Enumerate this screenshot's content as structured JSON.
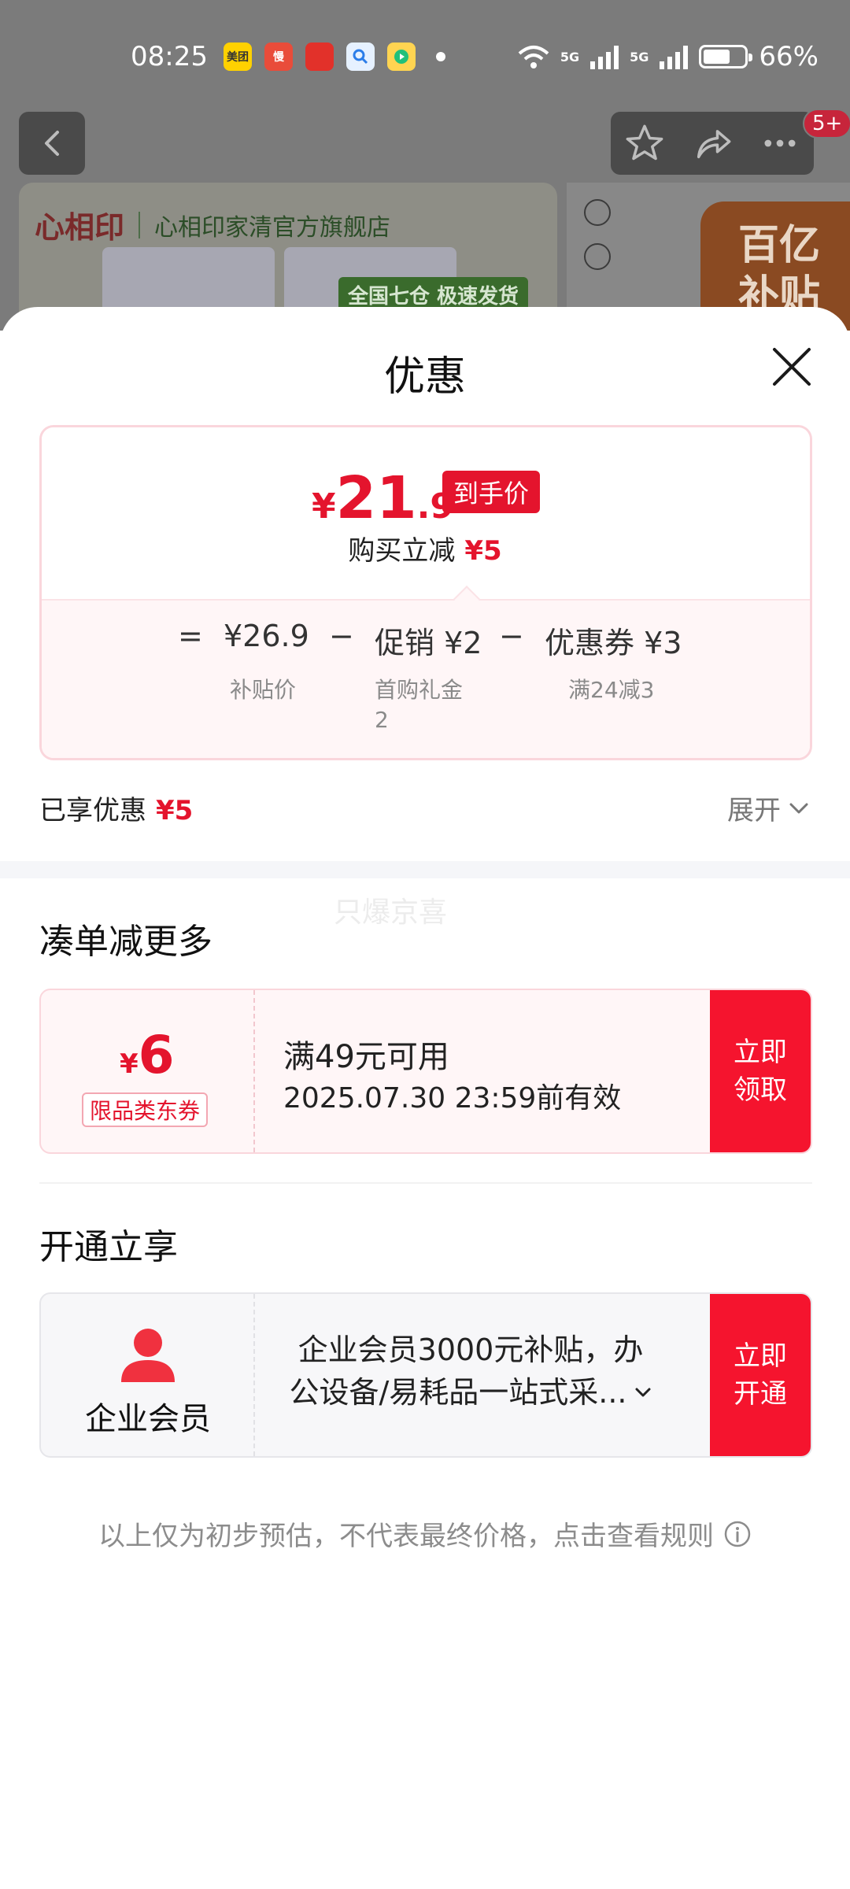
{
  "status_bar": {
    "time": "08:25",
    "app_icons": [
      {
        "name": "meituan-icon",
        "label": "美团",
        "color": "#ffd100"
      },
      {
        "name": "app-red-icon",
        "label": "慢",
        "color": "#e94c3a"
      },
      {
        "name": "app-pdd-icon",
        "label": "",
        "color": "#e2312a"
      },
      {
        "name": "app-search-icon",
        "label": "",
        "color": "#e6f1ff"
      },
      {
        "name": "app-video-icon",
        "label": "",
        "color": "#ffd451"
      }
    ],
    "signal1_label": "5G",
    "signal2_label": "5G",
    "battery_level": 0.66,
    "battery_text": "66%"
  },
  "background": {
    "store_logo": "心相印",
    "store_name": "心相印家清官方旗舰店",
    "banner_tag": "全国七仓 极速发货",
    "promo_badge_line1": "百亿",
    "promo_badge_line2": "补贴",
    "cart_badge": "5+"
  },
  "sheet": {
    "title": "优惠",
    "final_price": {
      "currency": "¥",
      "integer": "21",
      "decimal": ".9",
      "tag": "到手价"
    },
    "instant_discount": {
      "label": "购买立减",
      "amount": "¥5"
    },
    "breakdown": {
      "equals": "=",
      "minus": "−",
      "subsidy_price": "¥26.9",
      "subsidy_label": "补贴价",
      "promo": "促销 ¥2",
      "promo_label_line1": "首购礼金",
      "promo_label_line2": "2",
      "coupon": "优惠券 ¥3",
      "coupon_label": "满24减3"
    },
    "enjoyed": {
      "label": "已享优惠",
      "amount": "¥5"
    },
    "expand_label": "展开",
    "watermark": "只爆京喜",
    "more_section": {
      "title": "凑单减更多",
      "coupon": {
        "currency": "¥",
        "amount": "6",
        "type": "限品类东券",
        "condition": "满49元可用",
        "validity": "2025.07.30 23:59前有效",
        "button_line1": "立即",
        "button_line2": "领取"
      }
    },
    "open_section": {
      "title": "开通立享",
      "member": {
        "name": "企业会员",
        "desc_line1": "企业会员3000元补贴，办",
        "desc_line2": "公设备/易耗品一站式采...",
        "button_line1": "立即",
        "button_line2": "开通"
      }
    },
    "disclaimer": "以上仅为初步预估，不代表最终价格，点击查看规则"
  },
  "colors": {
    "accent_red": "#e4142d",
    "button_red": "#f5142e"
  }
}
